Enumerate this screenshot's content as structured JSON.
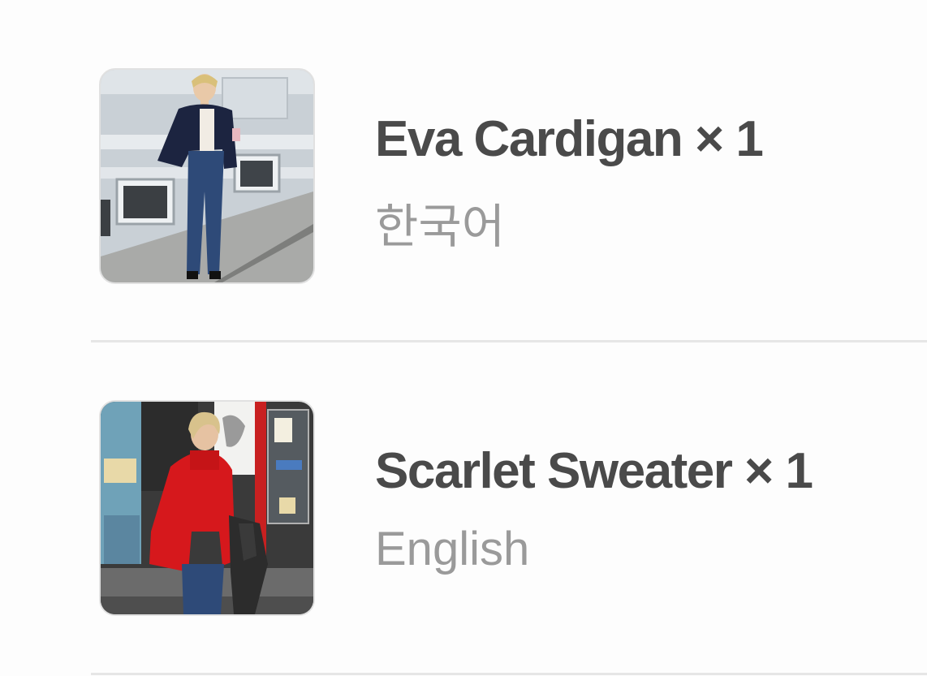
{
  "cart": {
    "items": [
      {
        "name": "Eva Cardigan",
        "quantity": "× 1",
        "title": "Eva Cardigan × 1",
        "language": "한국어",
        "thumbnail_icon": "product-photo-eva-cardigan"
      },
      {
        "name": "Scarlet Sweater",
        "quantity": "× 1",
        "title": "Scarlet Sweater × 1",
        "language": "English",
        "thumbnail_icon": "product-photo-scarlet-sweater"
      }
    ]
  },
  "colors": {
    "title": "#4a4a4a",
    "subtitle": "#9a9a9a",
    "divider": "#e6e6e6",
    "sweater_red": "#d6181c",
    "cardigan_navy": "#1c2440"
  }
}
